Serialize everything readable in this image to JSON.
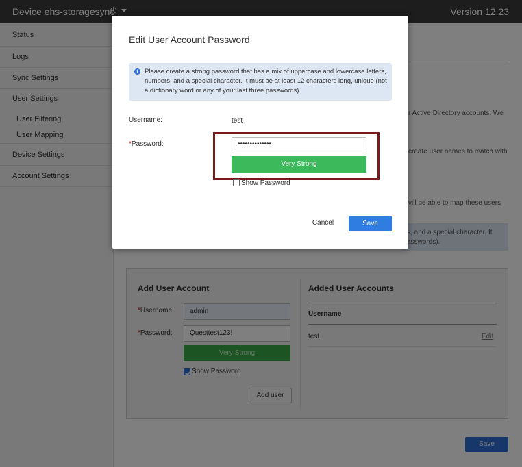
{
  "header": {
    "device_title": "Device ehs-storagesync",
    "power_icon": "⏻",
    "version": "Version 12.23"
  },
  "sidebar": {
    "items": [
      {
        "label": "Status"
      },
      {
        "label": "Logs"
      },
      {
        "label": "Sync Settings"
      },
      {
        "label": "User Settings"
      },
      {
        "label": "Device Settings"
      },
      {
        "label": "Account Settings"
      }
    ],
    "subitems": [
      {
        "label": "User Filtering"
      },
      {
        "label": "User Mapping"
      }
    ]
  },
  "background": {
    "text_1": "r Active Directory accounts. We",
    "text_2": "create user names to match with",
    "text_3": "vill be able to map these users",
    "alert_line_1": "s, and a special character. It",
    "alert_line_2": "asswords).",
    "add_account_title": "Add User Account",
    "added_accounts_title": "Added User Accounts",
    "username_label": "Username:",
    "password_label": "Password:",
    "required_mark": "*",
    "username_value": "admin",
    "password_value": "Questtest123!",
    "strength": "Very Strong",
    "show_password_label": "Show Password",
    "add_user_button": "Add user",
    "table_header": "Username",
    "table_rows": [
      {
        "username": "test",
        "action": "Edit"
      }
    ],
    "save_button": "Save"
  },
  "modal": {
    "title": "Edit User Account Password",
    "info_text": "Please create a strong password that has a mix of uppercase and lowercase letters, numbers, and a special character. It must be at least 12 characters long, unique (not a dictionary word or any of your last three passwords).",
    "username_label": "Username:",
    "username_value": "test",
    "password_label": "Password:",
    "required_mark": "*",
    "password_masked": "••••••••••••••",
    "strength": "Very Strong",
    "show_password_label": "Show Password",
    "cancel_label": "Cancel",
    "save_label": "Save"
  },
  "colors": {
    "header_bg": "#3a3a3a",
    "primary_blue": "#2f7de1",
    "strength_green": "#3cb95a",
    "highlight_border": "#7a1a1a",
    "info_bg": "#dde7f4"
  }
}
